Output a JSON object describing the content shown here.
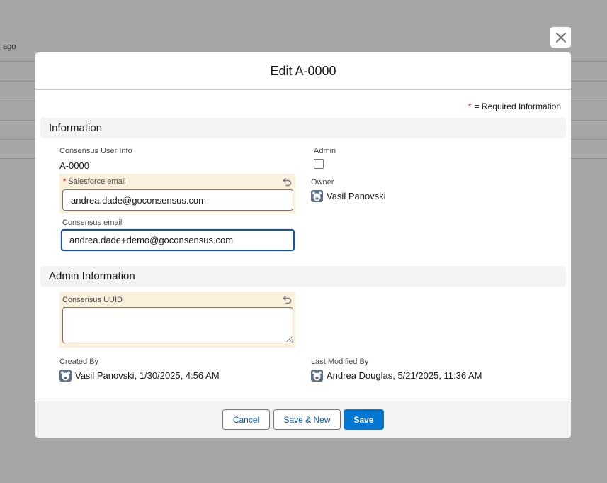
{
  "background": {
    "ago_text": "ago"
  },
  "modal": {
    "title": "Edit A-0000",
    "required_note": "= Required Information",
    "required_star": "*"
  },
  "sections": {
    "information": "Information",
    "admin_information": "Admin Information"
  },
  "fields": {
    "consensus_user_info": {
      "label": "Consensus User Info",
      "value": "A-0000"
    },
    "admin": {
      "label": "Admin",
      "checked": false
    },
    "salesforce_email": {
      "label": "Salesforce email",
      "value": "andrea.dade@goconsensus.com",
      "required": true
    },
    "owner": {
      "label": "Owner",
      "value": "Vasil Panovski"
    },
    "consensus_email": {
      "label": "Consensus email",
      "value": "andrea.dade+demo@goconsensus.com"
    },
    "consensus_uuid": {
      "label": "Consensus UUID",
      "value": ""
    },
    "created_by": {
      "label": "Created By",
      "value": "Vasil Panovski, 1/30/2025, 4:56 AM"
    },
    "last_modified_by": {
      "label": "Last Modified By",
      "value": "Andrea Douglas, 5/21/2025, 11:36 AM"
    }
  },
  "buttons": {
    "cancel": "Cancel",
    "save_new": "Save & New",
    "save": "Save"
  },
  "icons": {
    "close": "close-icon",
    "undo": "undo-icon",
    "avatar": "user-avatar-icon"
  },
  "colors": {
    "brand": "#0176d3",
    "edited_bg": "#fbf0dc",
    "required": "#ba0517",
    "focus": "#1b5297"
  }
}
